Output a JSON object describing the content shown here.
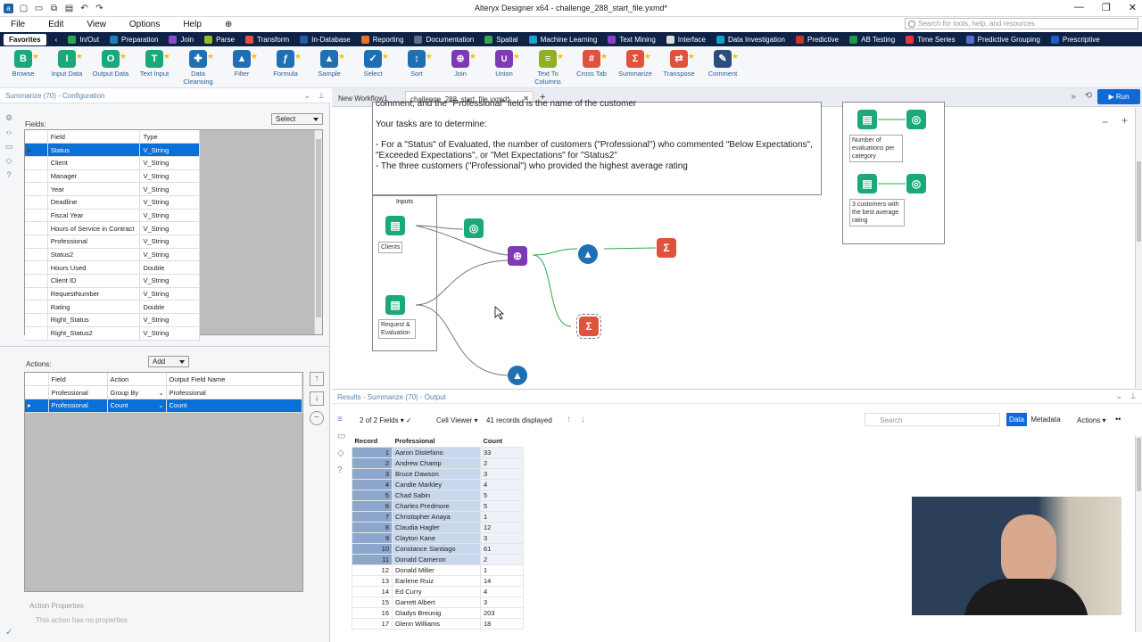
{
  "window": {
    "title": "Alteryx Designer x64 - challenge_288_start_file.yxmd*",
    "search_placeholder": "Search for tools, help, and resources"
  },
  "menu": [
    "File",
    "Edit",
    "View",
    "Options",
    "Help"
  ],
  "categories": [
    {
      "label": "Favorites",
      "color": "#ffffff",
      "active": true
    },
    {
      "label": "In/Out",
      "color": "#2aa84a"
    },
    {
      "label": "Preparation",
      "color": "#1d7fb5"
    },
    {
      "label": "Join",
      "color": "#8a4fc7"
    },
    {
      "label": "Parse",
      "color": "#9ab825"
    },
    {
      "label": "Transform",
      "color": "#e0523b"
    },
    {
      "label": "In-Database",
      "color": "#245ba5"
    },
    {
      "label": "Reporting",
      "color": "#e8722b"
    },
    {
      "label": "Documentation",
      "color": "#5b6f8a"
    },
    {
      "label": "Spatial",
      "color": "#39a44a"
    },
    {
      "label": "Machine Learning",
      "color": "#17a3d3"
    },
    {
      "label": "Text Mining",
      "color": "#8c3fc7"
    },
    {
      "label": "Interface",
      "color": "#dddddd"
    },
    {
      "label": "Data Investigation",
      "color": "#18a0c8"
    },
    {
      "label": "Predictive",
      "color": "#c8362a"
    },
    {
      "label": "AB Testing",
      "color": "#1b9a4a"
    },
    {
      "label": "Time Series",
      "color": "#e53935"
    },
    {
      "label": "Predictive Grouping",
      "color": "#5b6cd1"
    },
    {
      "label": "Prescriptive",
      "color": "#1e5fc8"
    }
  ],
  "tools": [
    {
      "label": "Browse",
      "color": "#1aa97a",
      "glyph": "B"
    },
    {
      "label": "Input Data",
      "color": "#1aa97a",
      "glyph": "I"
    },
    {
      "label": "Output Data",
      "color": "#1aa97a",
      "glyph": "O"
    },
    {
      "label": "Text Input",
      "color": "#1aa97a",
      "glyph": "T"
    },
    {
      "label": "Data Cleansing",
      "color": "#1f6fb5",
      "glyph": "✚"
    },
    {
      "label": "Filter",
      "color": "#1f6fb5",
      "glyph": "▲"
    },
    {
      "label": "Formula",
      "color": "#1f6fb5",
      "glyph": "ƒ"
    },
    {
      "label": "Sample",
      "color": "#1f6fb5",
      "glyph": "▲"
    },
    {
      "label": "Select",
      "color": "#1f6fb5",
      "glyph": "✓"
    },
    {
      "label": "Sort",
      "color": "#1f6fb5",
      "glyph": "↕"
    },
    {
      "label": "Join",
      "color": "#7e3ab5",
      "glyph": "⊕"
    },
    {
      "label": "Union",
      "color": "#7e3ab5",
      "glyph": "∪"
    },
    {
      "label": "Text To Columns",
      "color": "#8fb021",
      "glyph": "≡"
    },
    {
      "label": "Cross Tab",
      "color": "#e0523b",
      "glyph": "#"
    },
    {
      "label": "Summarize",
      "color": "#e0523b",
      "glyph": "Σ"
    },
    {
      "label": "Transpose",
      "color": "#e0523b",
      "glyph": "⇄"
    },
    {
      "label": "Comment",
      "color": "#2a4d80",
      "glyph": "✎"
    }
  ],
  "config": {
    "panel_title": "Summarize (70) - Configuration",
    "fields_label": "Fields:",
    "select_label": "Select",
    "col_field": "Field",
    "col_type": "Type",
    "fields": [
      {
        "name": "Status",
        "type": "V_String",
        "selected": true
      },
      {
        "name": "Client",
        "type": "V_String"
      },
      {
        "name": "Manager",
        "type": "V_String"
      },
      {
        "name": "Year",
        "type": "V_String"
      },
      {
        "name": "Deadline",
        "type": "V_String"
      },
      {
        "name": "Fiscal Year",
        "type": "V_String"
      },
      {
        "name": "Hours of Service in Contract",
        "type": "V_String"
      },
      {
        "name": "Professional",
        "type": "V_String"
      },
      {
        "name": "Status2",
        "type": "V_String"
      },
      {
        "name": "Hours Used",
        "type": "Double"
      },
      {
        "name": "Client ID",
        "type": "V_String"
      },
      {
        "name": "RequestNumber",
        "type": "V_String"
      },
      {
        "name": "Rating",
        "type": "Double"
      },
      {
        "name": "Right_Status",
        "type": "V_String"
      },
      {
        "name": "Right_Status2",
        "type": "V_String"
      }
    ],
    "add_label": "Add",
    "actions_label": "Actions:",
    "act_cols": [
      "Field",
      "Action",
      "Output Field Name"
    ],
    "actions": [
      {
        "field": "Professional",
        "action": "Group By",
        "output": "Professional"
      },
      {
        "field": "Professional",
        "action": "Count",
        "output": "Count",
        "selected": true
      }
    ],
    "action_props_label": "Action Properties",
    "no_props": "This action has no properties"
  },
  "canvas": {
    "tabs": [
      "New Workflow1",
      "challenge_288_start_file.yxmd*"
    ],
    "run_label": "Run",
    "comment_top": "comment, and the \"Professional\" field is the name of the customer",
    "tasks_title": "Your tasks are to determine:",
    "task1": "- For a \"Status\" of Evaluated,  the number of customers (\"Professional\") who commented \"Below Expectations\", \"Exceeded Expectations\", or \"Met Expectations\" for \"Status2\"",
    "task2": "- The three customers (\"Professional\") who provided the highest average rating",
    "inputs_label": "Inputs",
    "clients_label": "Clients",
    "request_label": "Request & Evaluation",
    "out1_label": "Number of evaluations per category",
    "out2_label": "3 customers with the best average rating"
  },
  "results": {
    "panel_title": "Results - Summarize (70) - Output",
    "fields_count": "2 of 2 Fields",
    "cell_viewer": "Cell Viewer",
    "records": "41 records displayed",
    "search_placeholder": "Search",
    "data_btn": "Data",
    "metadata_btn": "Metadata",
    "actions_btn": "Actions",
    "cols": [
      "Record",
      "Professional",
      "Count"
    ],
    "rows": [
      {
        "n": "1",
        "p": "Aaron Distefano",
        "c": "33"
      },
      {
        "n": "2",
        "p": "Andrew Champ",
        "c": "2"
      },
      {
        "n": "3",
        "p": "Bruce Dawson",
        "c": "3"
      },
      {
        "n": "4",
        "p": "Candie Markley",
        "c": "4"
      },
      {
        "n": "5",
        "p": "Chad Sabin",
        "c": "5"
      },
      {
        "n": "6",
        "p": "Charles Predmore",
        "c": "5"
      },
      {
        "n": "7",
        "p": "Christopher Anaya",
        "c": "1"
      },
      {
        "n": "8",
        "p": "Claudia Hagler",
        "c": "12"
      },
      {
        "n": "9",
        "p": "Clayton Kane",
        "c": "3"
      },
      {
        "n": "10",
        "p": "Constance Santiago",
        "c": "61"
      },
      {
        "n": "11",
        "p": "Donald Cameron",
        "c": "2"
      },
      {
        "n": "12",
        "p": "Donald Miller",
        "c": "1"
      },
      {
        "n": "13",
        "p": "Earlene Ruiz",
        "c": "14"
      },
      {
        "n": "14",
        "p": "Ed Curry",
        "c": "4"
      },
      {
        "n": "15",
        "p": "Garrett Albert",
        "c": "3"
      },
      {
        "n": "16",
        "p": "Gladys Breunig",
        "c": "203"
      },
      {
        "n": "17",
        "p": "Glenn Williams",
        "c": "18"
      }
    ]
  }
}
